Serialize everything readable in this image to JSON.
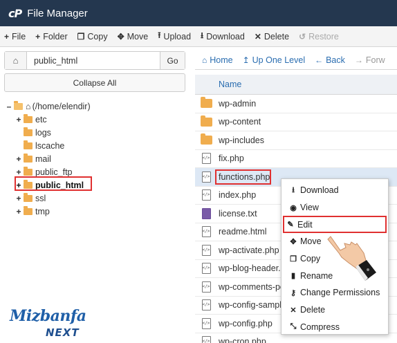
{
  "app": {
    "logo": "cP",
    "title": "File Manager"
  },
  "toolbar": {
    "items": [
      {
        "icon": "plus-icon",
        "glyph": "+",
        "label": "File"
      },
      {
        "icon": "plus-icon",
        "glyph": "+",
        "label": "Folder"
      },
      {
        "icon": "copy-icon",
        "glyph": "❐",
        "label": "Copy"
      },
      {
        "icon": "move-icon",
        "glyph": "✥",
        "label": "Move"
      },
      {
        "icon": "upload-icon",
        "glyph": "⭱",
        "label": "Upload"
      },
      {
        "icon": "download-icon",
        "glyph": "⭳",
        "label": "Download"
      },
      {
        "icon": "delete-icon",
        "glyph": "✕",
        "label": "Delete"
      },
      {
        "icon": "restore-icon",
        "glyph": "↺",
        "label": "Restore"
      }
    ]
  },
  "left_panel": {
    "path_value": "public_html",
    "go_label": "Go",
    "collapse_label": "Collapse All",
    "tree": {
      "root": {
        "toggle": "–",
        "label": "(/home/elendir)"
      },
      "items": [
        {
          "toggle": "+",
          "label": "etc"
        },
        {
          "toggle": "",
          "label": "logs"
        },
        {
          "toggle": "",
          "label": "lscache"
        },
        {
          "toggle": "+",
          "label": "mail"
        },
        {
          "toggle": "+",
          "label": "public_ftp"
        },
        {
          "toggle": "+",
          "label": "public_html"
        },
        {
          "toggle": "+",
          "label": "ssl"
        },
        {
          "toggle": "+",
          "label": "tmp"
        }
      ]
    }
  },
  "right_panel": {
    "nav": [
      {
        "icon": "home-icon",
        "glyph": "⌂",
        "label": "Home"
      },
      {
        "icon": "up-level-icon",
        "glyph": "↥",
        "label": "Up One Level"
      },
      {
        "icon": "back-icon",
        "glyph": "←",
        "label": "Back"
      },
      {
        "icon": "forward-icon",
        "glyph": "→",
        "label": "Forw"
      }
    ],
    "column_header": "Name",
    "files": [
      {
        "type": "folder",
        "name": "wp-admin"
      },
      {
        "type": "folder",
        "name": "wp-content"
      },
      {
        "type": "folder",
        "name": "wp-includes"
      },
      {
        "type": "code",
        "name": "fix.php"
      },
      {
        "type": "code",
        "name": "functions.php"
      },
      {
        "type": "code",
        "name": "index.php"
      },
      {
        "type": "text",
        "name": "license.txt"
      },
      {
        "type": "code",
        "name": "readme.html"
      },
      {
        "type": "code",
        "name": "wp-activate.php"
      },
      {
        "type": "code",
        "name": "wp-blog-header.p"
      },
      {
        "type": "code",
        "name": "wp-comments-po"
      },
      {
        "type": "code",
        "name": "wp-config-sample"
      },
      {
        "type": "code",
        "name": "wp-config.php"
      },
      {
        "type": "code",
        "name": "wp-cron.php"
      }
    ]
  },
  "context_menu": {
    "items": [
      {
        "icon": "download-icon",
        "glyph": "⭳",
        "label": "Download"
      },
      {
        "icon": "eye-icon",
        "glyph": "◉",
        "label": "View"
      },
      {
        "icon": "pencil-icon",
        "glyph": "✎",
        "label": "Edit"
      },
      {
        "icon": "move-icon",
        "glyph": "✥",
        "label": "Move"
      },
      {
        "icon": "copy-icon",
        "glyph": "❐",
        "label": "Copy"
      },
      {
        "icon": "file-icon",
        "glyph": "▮",
        "label": "Rename"
      },
      {
        "icon": "key-icon",
        "glyph": "⚷",
        "label": "Change Permissions"
      },
      {
        "icon": "delete-icon",
        "glyph": "✕",
        "label": "Delete"
      },
      {
        "icon": "compress-icon",
        "glyph": "⤡",
        "label": "Compress"
      }
    ]
  },
  "brand": {
    "line1": "Mizbanfa",
    "line2": "NEXT"
  },
  "colors": {
    "titlebar": "#24374f",
    "link": "#2a6db0",
    "folder": "#f0ad4e",
    "highlight": "#e03030",
    "brand": "#1f5fa8"
  }
}
